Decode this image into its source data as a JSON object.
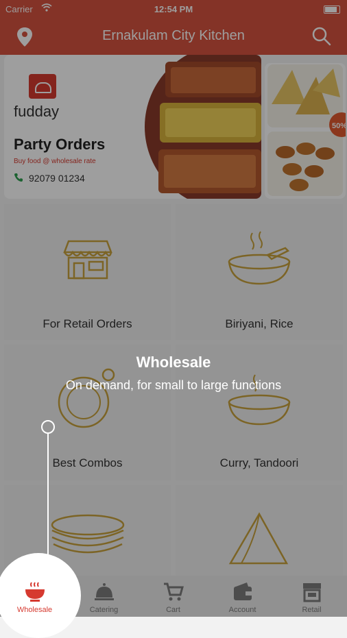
{
  "statusbar": {
    "carrier": "Carrier",
    "time": "12:54 PM"
  },
  "appbar": {
    "title": "Ernakulam City Kitchen",
    "location_icon": "location-pin-icon",
    "search_icon": "search-icon"
  },
  "banner": {
    "brand": "fudday",
    "headline": "Party Orders",
    "subline": "Buy food @ wholesale rate",
    "phone": "92079 01234",
    "badge": "50%"
  },
  "tiles": [
    {
      "label": "For Retail Orders",
      "icon": "store-icon"
    },
    {
      "label": "Biriyani, Rice",
      "icon": "biryani-bowl-icon"
    },
    {
      "label": "Best Combos",
      "icon": "combo-plate-icon"
    },
    {
      "label": "Curry, Tandoori",
      "icon": "curry-bowl-icon"
    },
    {
      "label": "",
      "icon": "bread-stack-icon"
    },
    {
      "label": "",
      "icon": "samosa-icon"
    }
  ],
  "coachmark": {
    "title": "Wholesale",
    "text": "On demand, for small to large functions"
  },
  "tabbar": {
    "tabs": [
      {
        "label": "Wholesale",
        "icon": "wholesale-bowl-icon"
      },
      {
        "label": "Catering",
        "icon": "cloche-icon"
      },
      {
        "label": "Cart",
        "icon": "cart-icon"
      },
      {
        "label": "Account",
        "icon": "wallet-icon"
      },
      {
        "label": "Retail",
        "icon": "shop-icon"
      }
    ]
  },
  "colors": {
    "brand": "#d6533f",
    "accent": "#d63a30",
    "icon_gold": "#c8a23c"
  }
}
